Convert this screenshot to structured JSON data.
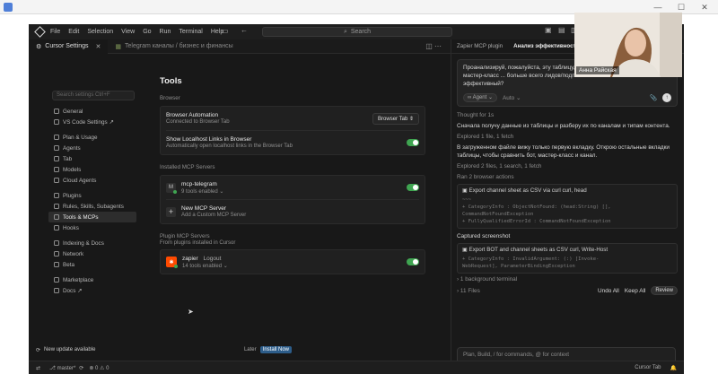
{
  "window": {
    "minimize": "—",
    "maximize": "☐",
    "close": "✕"
  },
  "menu": [
    "File",
    "Edit",
    "Selection",
    "View",
    "Go",
    "Run",
    "Terminal",
    "Help"
  ],
  "command_center": {
    "placeholder": "Search"
  },
  "editor_tabs": [
    {
      "label": "Cursor Settings",
      "active": true
    },
    {
      "label": "Telegram каналы / бизнес и финансы",
      "active": false
    }
  ],
  "settings_search": {
    "placeholder": "Search settings Ctrl+F"
  },
  "sidebar": {
    "groups": [
      [
        {
          "label": "General"
        },
        {
          "label": "VS Code Settings ↗"
        }
      ],
      [
        {
          "label": "Plan & Usage"
        },
        {
          "label": "Agents"
        },
        {
          "label": "Tab"
        },
        {
          "label": "Models"
        },
        {
          "label": "Cloud Agents"
        }
      ],
      [
        {
          "label": "Plugins"
        },
        {
          "label": "Rules, Skills, Subagents"
        },
        {
          "label": "Tools & MCPs",
          "active": true
        },
        {
          "label": "Hooks"
        }
      ],
      [
        {
          "label": "Indexing & Docs"
        },
        {
          "label": "Network"
        },
        {
          "label": "Beta"
        }
      ],
      [
        {
          "label": "Marketplace"
        },
        {
          "label": "Docs ↗"
        }
      ]
    ]
  },
  "main": {
    "title": "Tools",
    "browser_section": "Browser",
    "browser_automation": {
      "title": "Browser Automation",
      "subtitle": "Connected to Browser Tab",
      "select_value": "Browser Tab"
    },
    "show_localhost": {
      "title": "Show Localhost Links in Browser",
      "subtitle": "Automatically open localhost links in the Browser Tab",
      "enabled": true
    },
    "installed_section": "Installed MCP Servers",
    "mcp_telegram": {
      "badge": "M",
      "name": "mcp-telegram",
      "tools": "9 tools enabled",
      "enabled": true
    },
    "new_mcp": {
      "title": "New MCP Server",
      "subtitle": "Add a Custom MCP Server"
    },
    "plugin_section": "Plugin MCP Servers",
    "plugin_sub": "From plugins installed in Cursor",
    "zapier": {
      "name": "zapier",
      "action": "Logout",
      "tools": "14 tools enabled",
      "enabled": true
    }
  },
  "update": {
    "text": "New update available",
    "later": "Later",
    "install": "Install Now"
  },
  "statusbar": {
    "branch": "master*",
    "errors": "0",
    "warnings": "0",
    "right_label": "Cursor Tab"
  },
  "right_panel": {
    "tabs": [
      {
        "label": "Zapier MCP plugin"
      },
      {
        "label": "Анализ эффективности рек",
        "active": true
      }
    ],
    "user_prompt": "Проанализируй, пожалуйста, эту таблицу, ... и на какой вид контента (бот, мастер-класс ... больше всего лидов/подписок? Какой из них самый эффективный?",
    "agent_pill": "Agent",
    "auto_label": "Auto",
    "thought": "Thought for 1s",
    "msg1": "Сначала получу данные из таблицы и разберу их по каналам и типам контента.",
    "explored1": "Explored 1 file, 1 fetch",
    "msg2": "В загруженном файле вижу только первую вкладку. Открою остальные вкладки таблицы, чтобы сравнить бот, мастер-класс и канал.",
    "explored2": "Explored 2 files, 1 search, 1 fetch",
    "ran": "Ran 2 browser actions",
    "code1_head": "Export channel sheet as CSV via curl curl, head",
    "code1_lines": [
      "~~~",
      "+ CategoryInfo          : ObjectNotFound: (head:String) [],",
      "CommandNotFoundException",
      "+ FullyQualifiedErrorId : CommandNotFoundException"
    ],
    "captured": "Captured screenshot",
    "code2_head": "Export BOT and channel sheets as CSV curl, Write-Host",
    "code2_lines": [
      "+ CategoryInfo          : InvalidArgument: (:) [Invoke-",
      "WebRequest], ParameterBindingException",
      "+ FullyQualifiedErrorId"
    ],
    "bg_terminal": "1 background terminal",
    "files_count": "11 Files",
    "undo_all": "Undo All",
    "keep_all": "Keep All",
    "review": "Review",
    "composer_placeholder": "Plan, Build, / for commands, @ for context"
  },
  "webcam": {
    "name": "Анна Райская"
  }
}
